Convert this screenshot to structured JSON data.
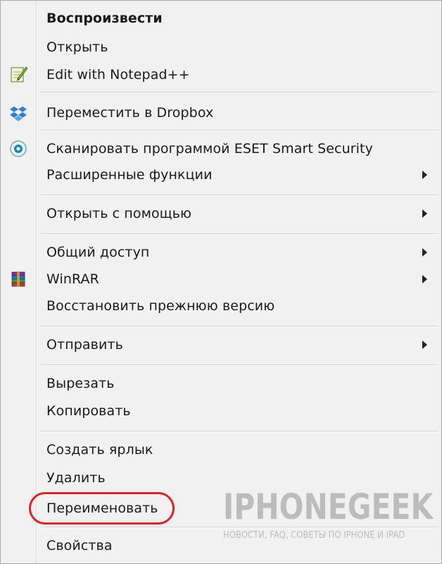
{
  "menu": {
    "items": [
      {
        "label": "Воспроизвести",
        "bold": true
      },
      {
        "label": "Открыть"
      },
      {
        "label": "Edit with Notepad++",
        "icon": "notepad-plus-plus-icon"
      },
      {
        "label": "Переместить в Dropbox",
        "icon": "dropbox-icon"
      },
      {
        "label": "Сканировать программой ESET Smart Security",
        "icon": "eset-icon"
      },
      {
        "label": "Расширенные функции",
        "submenu": true
      },
      {
        "label": "Открыть с помощью",
        "submenu": true
      },
      {
        "label": "Общий доступ",
        "submenu": true
      },
      {
        "label": "WinRAR",
        "icon": "winrar-icon",
        "submenu": true
      },
      {
        "label": "Восстановить прежнюю версию"
      },
      {
        "label": "Отправить",
        "submenu": true
      },
      {
        "label": "Вырезать"
      },
      {
        "label": "Копировать"
      },
      {
        "label": "Создать ярлык"
      },
      {
        "label": "Удалить"
      },
      {
        "label": "Переименовать",
        "highlighted": true
      },
      {
        "label": "Свойства"
      }
    ],
    "highlight_color": "#d8242a"
  },
  "watermark": {
    "title": "IPHONEGEEK",
    "subtitle": "НОВОСТИ, FAQ, СОВЕТЫ ПО IPHONE И IPAD"
  }
}
